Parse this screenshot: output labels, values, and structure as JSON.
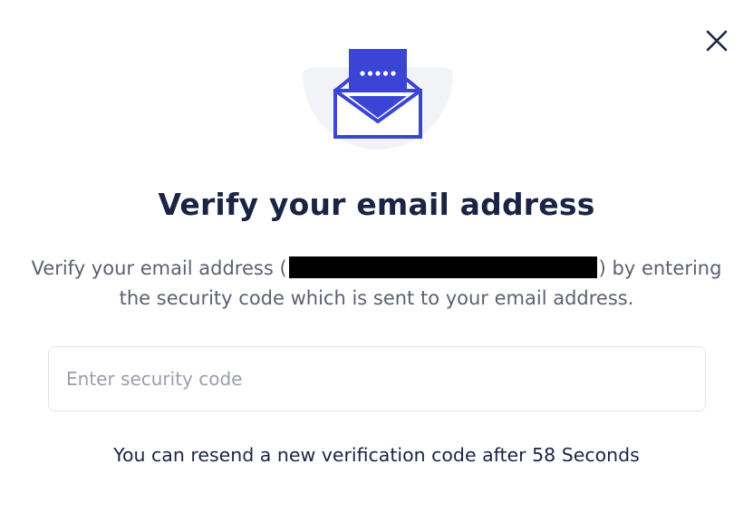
{
  "dialog": {
    "close_icon": "close-icon",
    "hero_icon": "email-envelope-icon",
    "title": "Verify your email address",
    "description_before": "Verify your email address (",
    "description_after": ") by entering the security code which is sent to your email address.",
    "code_input": {
      "value": "",
      "placeholder": "Enter security code"
    },
    "resend_text": "You can resend a new verification code after 58 Seconds"
  },
  "colors": {
    "accent": "#3a45d6",
    "title_text": "#1b2444",
    "body_text": "#5c6172",
    "circle_bg": "#f2f3f7"
  }
}
